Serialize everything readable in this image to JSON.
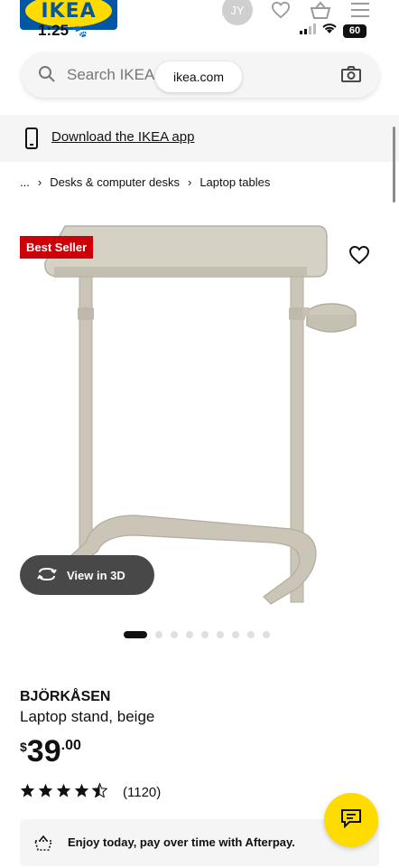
{
  "brand": {
    "logo_text": "IKEA",
    "logo_colors": {
      "blue": "#0058a3",
      "yellow": "#ffdb00"
    }
  },
  "header": {
    "avatar_initials": "JY",
    "icons": [
      "heart-icon",
      "basket-icon",
      "menu-icon"
    ]
  },
  "status_bar": {
    "time": "1:25",
    "battery": "60"
  },
  "search": {
    "placeholder": "Search IKEA",
    "url": "ikea.com"
  },
  "app_banner": {
    "link_text": "Download the IKEA app"
  },
  "breadcrumb": {
    "items": [
      "...",
      "Desks & computer desks",
      "Laptop tables"
    ],
    "separator": "›"
  },
  "product": {
    "badge": "Best Seller",
    "view_3d_label": "View in 3D",
    "carousel": {
      "total": 9,
      "active_index": 0
    },
    "name": "BJÖRKÅSEN",
    "description": "Laptop stand, beige",
    "price": {
      "currency": "$",
      "integer": "39",
      "decimal": ".00"
    },
    "rating": {
      "stars": 4.5,
      "max": 5,
      "count": "(1120)"
    },
    "afterpay_text": "Enjoy today, pay over time with Afterpay."
  },
  "colors": {
    "badge_red": "#cc0008",
    "chat_yellow": "#ffdb00",
    "pill_dark": "#484848"
  }
}
